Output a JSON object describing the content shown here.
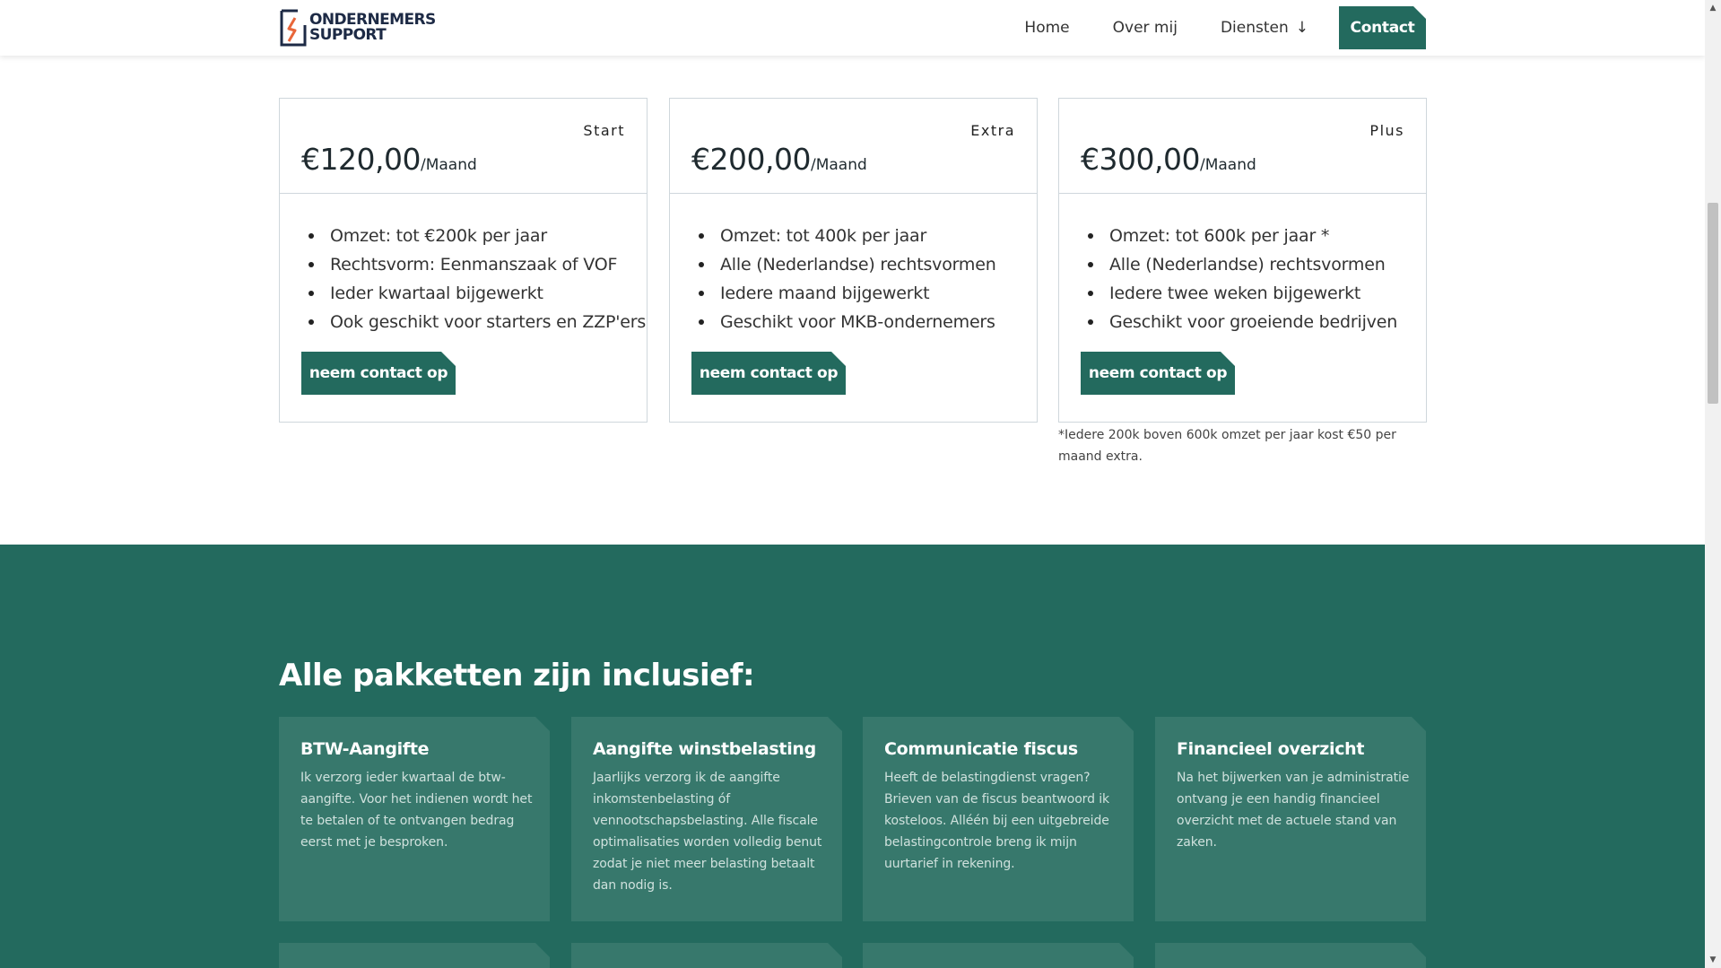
{
  "header": {
    "logo_line1": "ONDERNEMERS",
    "logo_line2": "SUPPORT",
    "nav": {
      "home": "Home",
      "about": "Over mij",
      "services": "Diensten",
      "contact": "Contact"
    },
    "icons": {
      "services_arrow": "arrow-down-icon"
    }
  },
  "pricing": {
    "cards": [
      {
        "tier": "Start",
        "price": "€120,00",
        "unit": "/Maand",
        "features": [
          "Omzet: tot €200k per jaar",
          "Rechtsvorm: Eenmanszaak of VOF",
          "Ieder kwartaal bijgewerkt",
          "Ook geschikt voor starters en ZZP'ers"
        ],
        "button": "neem contact op"
      },
      {
        "tier": "Extra",
        "price": "€200,00",
        "unit": "/Maand",
        "features": [
          "Omzet: tot 400k per jaar",
          "Alle (Nederlandse) rechtsvormen",
          "Iedere maand bijgewerkt",
          "Geschikt voor MKB-ondernemers"
        ],
        "button": "neem contact op"
      },
      {
        "tier": "Plus",
        "price": "€300,00",
        "unit": "/Maand",
        "features": [
          "Omzet: tot 600k per jaar *",
          "Alle (Nederlandse) rechtsvormen",
          "Iedere twee weken bijgewerkt",
          "Geschikt voor groeiende bedrijven"
        ],
        "button": "neem contact op"
      }
    ],
    "footnote": "*Iedere 200k boven 600k omzet per jaar kost €50 per maand extra."
  },
  "included": {
    "title": "Alle pakketten zijn inclusief:",
    "items": [
      {
        "title": "BTW-Aangifte",
        "text": "Ik verzorg ieder kwartaal de btw-aangifte. Voor het indienen wordt het te betalen of te ontvangen bedrag eerst met je besproken."
      },
      {
        "title": "Aangifte winstbelasting",
        "text": "Jaarlijks verzorg ik de aangifte inkomstenbelasting óf vennootschapsbelasting. Alle fiscale optimalisaties worden volledig benut zodat je niet meer belasting betaalt dan nodig is."
      },
      {
        "title": "Communicatie fiscus",
        "text": "Heeft de belastingdienst vragen? Brieven van de fiscus beantwoord ik kosteloos. Alléén bij een uitgebreide belastingcontrole breng ik mijn uurtarief in rekening."
      },
      {
        "title": "Financieel overzicht",
        "text": "Na het bijwerken van je administratie ontvang je een handig financieel overzicht met de actuele stand van zaken."
      }
    ]
  },
  "colors": {
    "brand_green": "#236a5e",
    "card_green": "#37786c",
    "logo_orange": "#e8663a",
    "logo_navy": "#1d2a45"
  }
}
